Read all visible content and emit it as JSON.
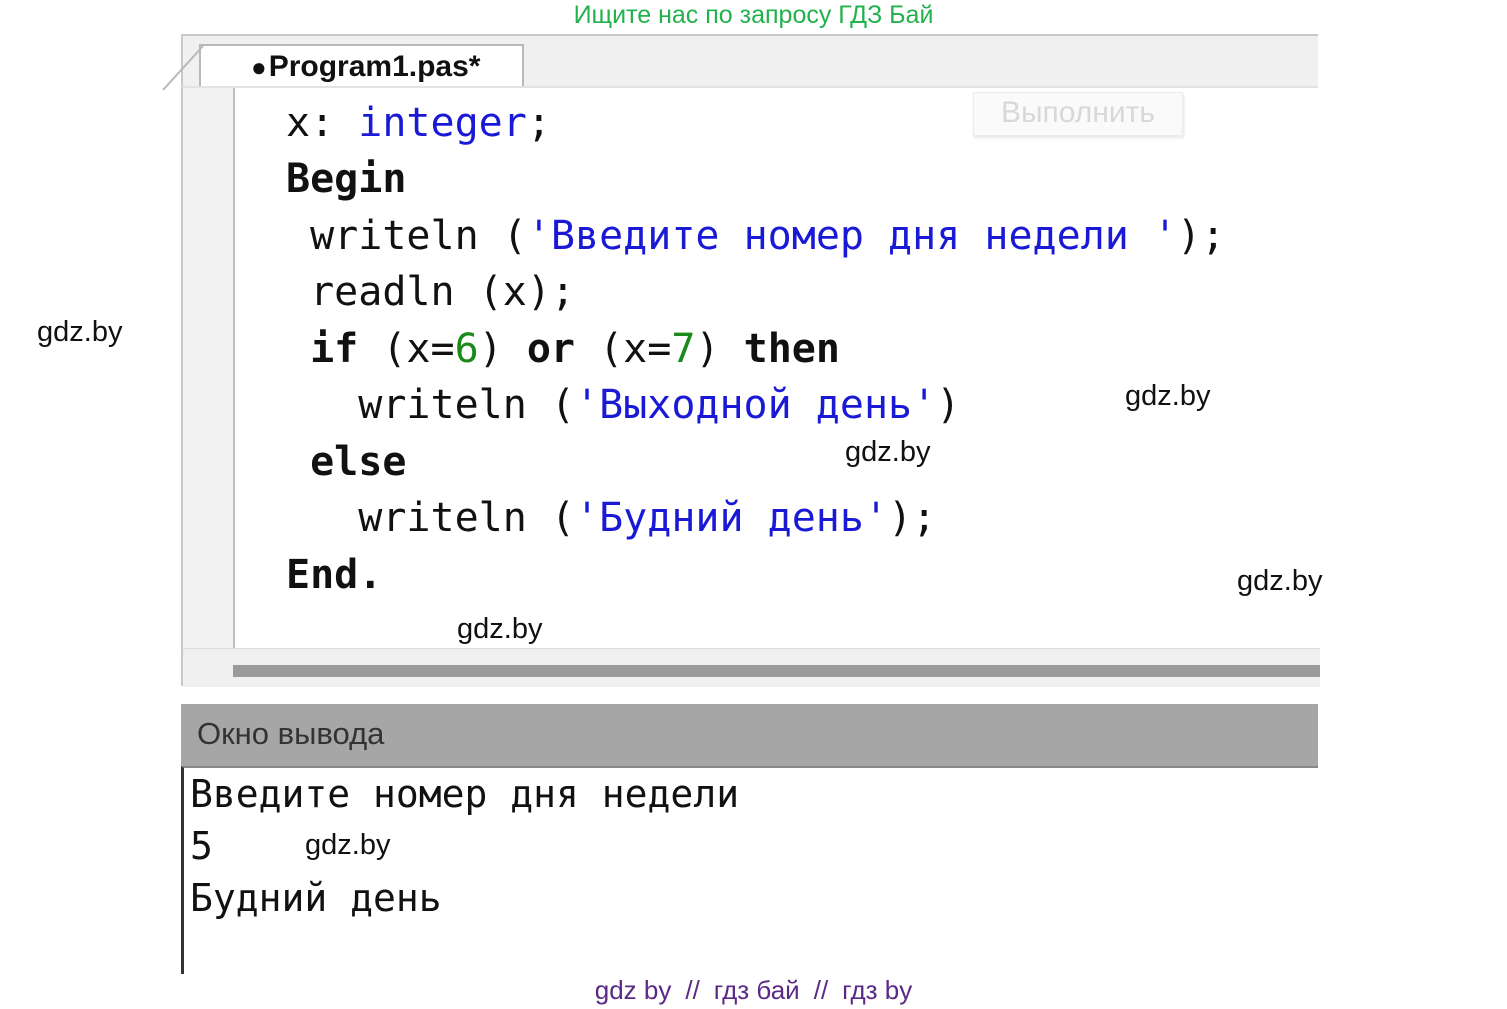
{
  "watermark_top": "Ищите нас по запросу ГДЗ Бай",
  "watermarks": [
    "gdz.by",
    "gdz.by",
    "gdz.by",
    "gdz.by",
    "gdz.by",
    "gdz.by"
  ],
  "watermark_bottom": [
    "gdz by",
    "//",
    "гдз бай",
    "//",
    "гдз by"
  ],
  "tab": {
    "label": "Program1.pas*"
  },
  "toolbar": {
    "run_label": "Выполнить"
  },
  "code": {
    "l1_var": "x: ",
    "l1_type": "integer",
    "l1_end": ";",
    "l2": "Begin",
    "l3_fn": " writeln (",
    "l3_str": "'Введите номер дня недели '",
    "l3_end": ");",
    "l4": " readln (x);",
    "l5_if": " if",
    "l5_a": " (x=",
    "l5_n1": "6",
    "l5_b": ") ",
    "l5_or": "or",
    "l5_c": " (x=",
    "l5_n2": "7",
    "l5_d": ") ",
    "l5_then": "then",
    "l6_fn": "   writeln (",
    "l6_str": "'Выходной день'",
    "l6_end": ")",
    "l7": " else",
    "l8_fn": "   writeln (",
    "l8_str": "'Будний день'",
    "l8_end": ");",
    "l9": "End."
  },
  "output": {
    "title": "Окно вывода",
    "lines": [
      "Введите номер дня недели",
      "5",
      "Будний день"
    ]
  }
}
